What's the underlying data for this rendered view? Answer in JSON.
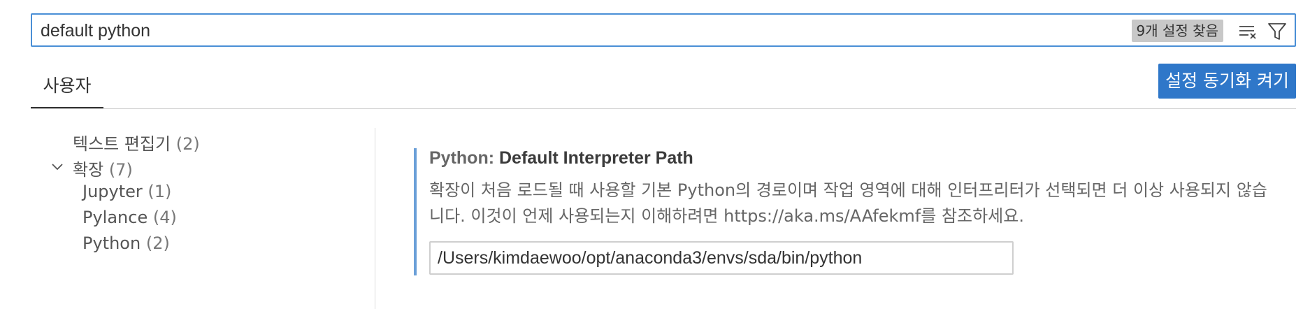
{
  "search": {
    "value": "default python",
    "result_count": "9개 설정 찾음",
    "clear_icon": "clear-filter-icon",
    "filter_icon": "filter-icon"
  },
  "tabs": {
    "user_label": "사용자",
    "sync_button_label": "설정 동기화 켜기"
  },
  "toc": {
    "items": [
      {
        "label": "텍스트 편집기",
        "count": "(2)"
      },
      {
        "label": "확장",
        "count": "(7)",
        "expanded": true
      },
      {
        "label": "Jupyter",
        "count": "(1)"
      },
      {
        "label": "Pylance",
        "count": "(4)"
      },
      {
        "label": "Python",
        "count": "(2)"
      }
    ]
  },
  "setting": {
    "category": "Python: ",
    "name": "Default Interpreter Path",
    "description": "확장이 처음 로드될 때 사용할 기본 Python의 경로이며 작업 영역에 대해 인터프리터가 선택되면 더 이상 사용되지 않습니다. 이것이 언제 사용되는지 이해하려면 https://aka.ms/AAfekmf를 참조하세요.",
    "value": "/Users/kimdaewoo/opt/anaconda3/envs/sda/bin/python"
  },
  "colors": {
    "accent": "#2f77c9",
    "focus_border": "#4a8fd6",
    "setting_modified_bar": "#6a9fd8"
  }
}
